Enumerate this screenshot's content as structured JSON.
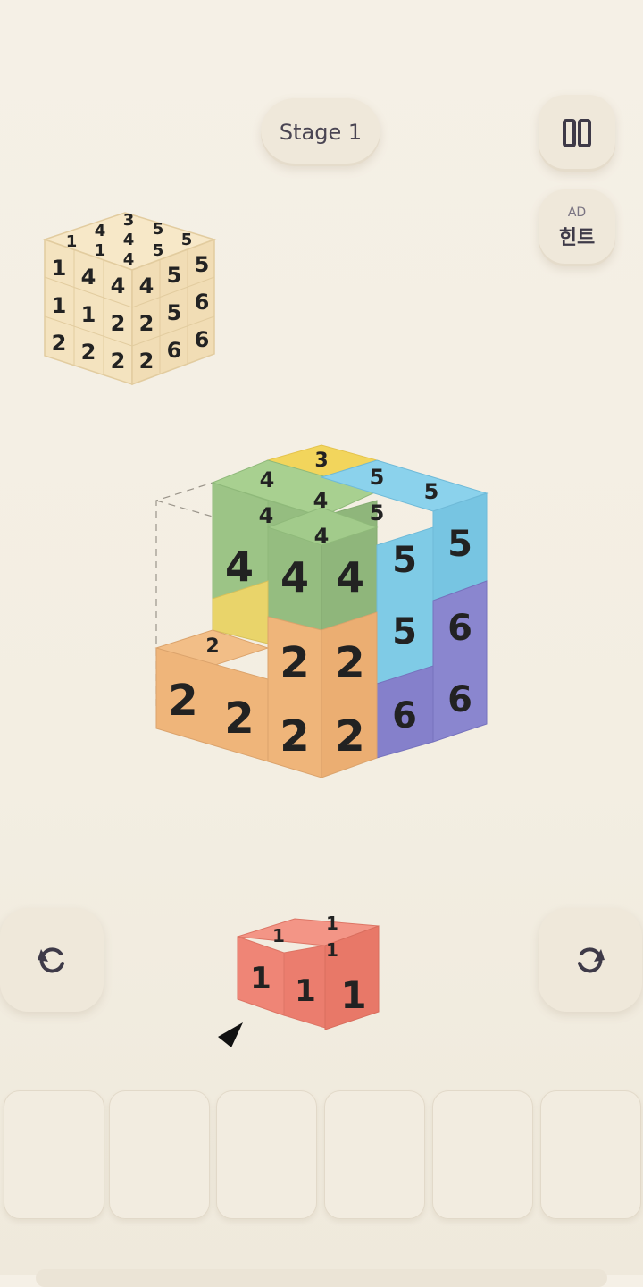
{
  "header": {
    "stage_label": "Stage 1"
  },
  "hint": {
    "ad_label": "AD",
    "label": "힌트"
  },
  "icons": {
    "pause": "pause-icon",
    "rotate_left": "rotate-left-icon",
    "rotate_right": "rotate-right-icon",
    "pointer": "pointer-arrow-icon"
  },
  "colors": {
    "background": "#f4efe4",
    "preview_cube": "#f4e3bf",
    "green": "#9cc486",
    "yellow": "#f2d55c",
    "blue": "#7fcbe6",
    "purple": "#8a86cf",
    "orange": "#efb57a",
    "red": "#ef8576",
    "text": "#4a4553"
  },
  "preview": {
    "top_numbers": [
      "3",
      "4",
      "5",
      "1",
      "4",
      "5",
      "1",
      "4",
      "5"
    ],
    "front_rows": [
      [
        "1",
        "4",
        "4"
      ],
      [
        "1",
        "1",
        "2"
      ],
      [
        "2",
        "2",
        "2"
      ]
    ],
    "right_rows": [
      [
        "4",
        "5",
        "5"
      ],
      [
        "2",
        "5",
        "6"
      ],
      [
        "2",
        "6",
        "6"
      ]
    ]
  },
  "puzzle": {
    "piece_numbers": {
      "green": "4",
      "yellow": "3",
      "blue": "5",
      "purple": "6",
      "orange": "2"
    }
  },
  "current_piece": {
    "number": "1"
  },
  "tray": {
    "slot_count": 6
  }
}
